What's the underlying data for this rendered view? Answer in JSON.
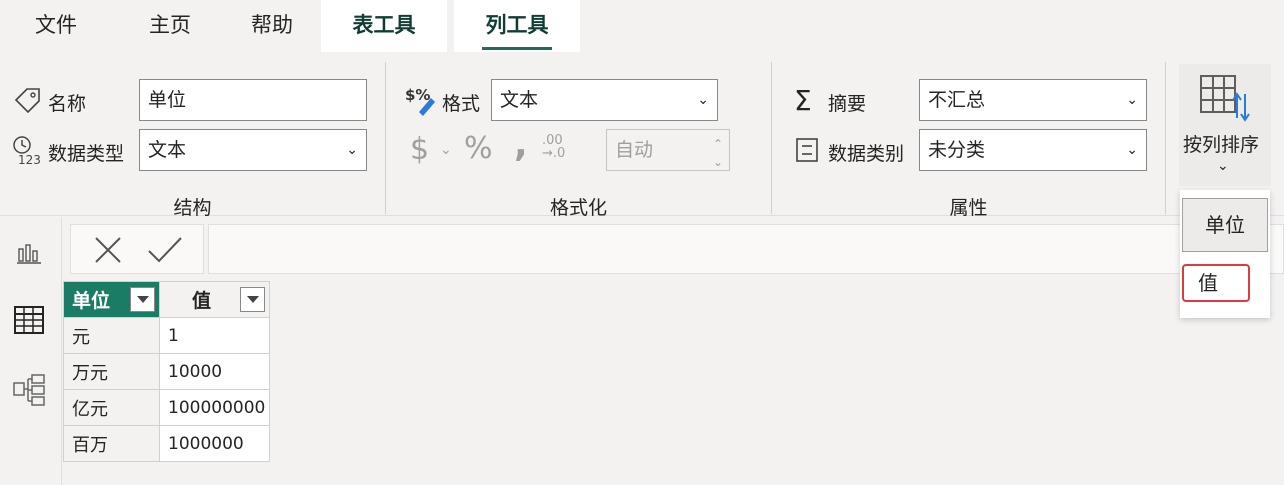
{
  "tabs": [
    {
      "label": "文件"
    },
    {
      "label": "主页"
    },
    {
      "label": "帮助"
    },
    {
      "label": "表工具"
    },
    {
      "label": "列工具"
    }
  ],
  "structure": {
    "name_label": "名称",
    "name_value": "单位",
    "datatype_label": "数据类型",
    "datatype_value": "文本",
    "group_label": "结构"
  },
  "formatting": {
    "format_label": "格式",
    "format_value": "文本",
    "currency_symbol": "$",
    "percent_symbol": "%",
    "comma_symbol": ",",
    "decimal_symbol": ".00",
    "auto_value": "自动",
    "group_label": "格式化"
  },
  "properties": {
    "summary_label": "摘要",
    "summary_value": "不汇总",
    "category_label": "数据类别",
    "category_value": "未分类",
    "group_label": "属性"
  },
  "sort": {
    "label": "按列排序",
    "options": [
      "单位",
      "值"
    ]
  },
  "table": {
    "headers": [
      "单位",
      "值"
    ],
    "rows": [
      [
        "元",
        "1"
      ],
      [
        "万元",
        "10000"
      ],
      [
        "亿元",
        "100000000"
      ],
      [
        "百万",
        "1000000"
      ]
    ]
  },
  "colors": {
    "accent": "#1b7c66",
    "highlight": "#e0393e"
  }
}
